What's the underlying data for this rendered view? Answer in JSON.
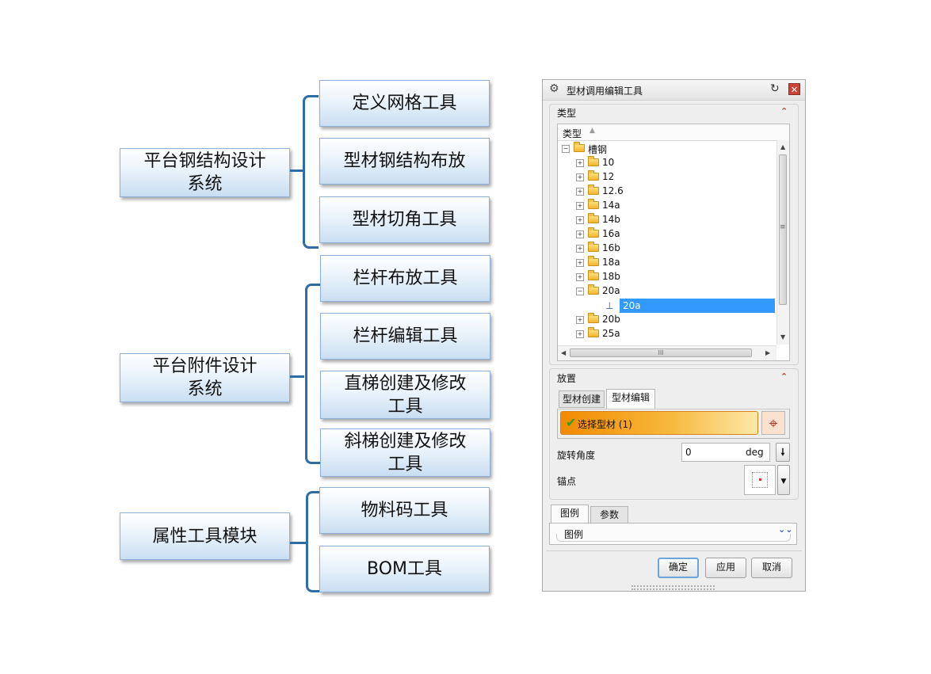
{
  "diagram": {
    "groups": [
      {
        "label": "平台钢结构设计\n系统",
        "items": [
          "定义网格工具",
          "型材钢结构布放",
          "型材切角工具"
        ]
      },
      {
        "label": "平台附件设计\n系统",
        "items": [
          "栏杆布放工具",
          "栏杆编辑工具",
          "直梯创建及修改\n工具",
          "斜梯创建及修改\n工具"
        ]
      },
      {
        "label": "属性工具模块",
        "items": [
          "物料码工具",
          "BOM工具"
        ]
      }
    ]
  },
  "dialog": {
    "title": "型材调用编辑工具",
    "type_section": {
      "title": "类型",
      "column_header": "类型",
      "root": "槽钢",
      "nodes": [
        "10",
        "12",
        "12.6",
        "14a",
        "14b",
        "16a",
        "16b",
        "18a",
        "18b",
        "20a",
        "20b",
        "25a"
      ],
      "selected_child": "20a",
      "hscroll_grip": "III",
      "vscroll_grip": "≡"
    },
    "placement_section": {
      "title": "放置",
      "tabs": [
        "型材创建",
        "型材编辑"
      ],
      "active_tab": "型材编辑",
      "select_label": "选择型材 (1)",
      "rotation_label": "旋转角度",
      "rotation_value": "0",
      "rotation_unit": "deg",
      "anchor_label": "锚点"
    },
    "bottom_tabs": [
      "图例",
      "参数"
    ],
    "active_bottom_tab": "图例",
    "legend_label": "图例",
    "buttons": {
      "ok": "确定",
      "apply": "应用",
      "cancel": "取消"
    }
  }
}
